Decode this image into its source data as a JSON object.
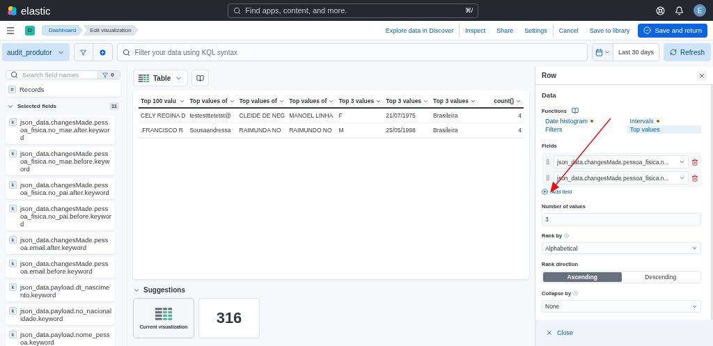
{
  "header": {
    "logo": "elastic",
    "search_placeholder": "Find apps, content, and more.",
    "shortcut": "⌘/",
    "avatar": "E"
  },
  "nav": {
    "app_badge": "D",
    "breadcrumbs": [
      {
        "label": "Dashboard",
        "selected": false
      },
      {
        "label": "Edit visualization",
        "selected": true
      }
    ],
    "actions": [
      {
        "label": "Explore data in Discover",
        "kind": "link"
      },
      {
        "label": "Inspect",
        "kind": "link"
      },
      {
        "label": "Share",
        "kind": "link"
      },
      {
        "label": "Settings",
        "kind": "link"
      },
      {
        "label": "Cancel",
        "kind": "link"
      },
      {
        "label": "Save to library",
        "kind": "link"
      },
      {
        "label": "Save and return",
        "kind": "primary"
      }
    ]
  },
  "query": {
    "data_view": "audit_produtor",
    "placeholder": "Filter your data using KQL syntax",
    "date_range": "Last 30 days",
    "refresh": "Refresh"
  },
  "sidebar": {
    "search_placeholder": "Search field names",
    "filter_count": "0",
    "records": {
      "type": "#",
      "name": "Records"
    },
    "selected_fields": {
      "label": "Selected fields",
      "count": "11",
      "expanded": true
    },
    "fields": [
      {
        "type": "k",
        "name": "json_data.changesMade.pessoa_fisica.no_mae.after.keyword"
      },
      {
        "type": "k",
        "name": "json_data.changesMade.pessoa_fisica.no_mae.before.keyword"
      },
      {
        "type": "k",
        "name": "json_data.changesMade.pessoa_fisica.no_pai.after.keyword"
      },
      {
        "type": "k",
        "name": "json_data.changesMade.pessoa_fisica.no_pai.before.keyword"
      },
      {
        "type": "k",
        "name": "json_data.changesMade.pessoa.email.after.keyword"
      },
      {
        "type": "k",
        "name": "json_data.changesMade.pessoa.email.before.keyword"
      },
      {
        "type": "k",
        "name": "json_data.payload.dt_nascimento.keyword"
      },
      {
        "type": "k",
        "name": "json_data.payload.no_nacionalidade.keyword"
      },
      {
        "type": "k",
        "name": "json_data.payload.nome_pessoa.keyword"
      }
    ]
  },
  "toolbar": {
    "chart_type": "Table"
  },
  "table": {
    "columns": [
      "Top 100 valu",
      "Top values of",
      "Top values of",
      "Top values of",
      "Top 3 values",
      "Top 3 values",
      "Top 3 values",
      "count()"
    ],
    "rows": [
      [
        "CELY REGINA D",
        "testestttetetst@",
        "CLEIDE DE NEG",
        "MANOEL LINHA",
        "F",
        "21/07/1975",
        "Brasileira",
        "4"
      ],
      [
        ".FRANCISCO R",
        "Sousaandressa",
        "RAIMUNDA NO",
        "RAIMUNDO NO",
        "M",
        "25/05/1998",
        "Brasileira",
        "4"
      ]
    ]
  },
  "suggestions": {
    "title": "Suggestions",
    "items": [
      {
        "kind": "chart",
        "label": "Current visualization"
      },
      {
        "kind": "metric",
        "value": "316"
      }
    ]
  },
  "panel": {
    "title": "Row",
    "section": "Data",
    "functions_label": "Functions",
    "functions": [
      {
        "label": "Date histogram",
        "selected": false,
        "dot": true
      },
      {
        "label": "Intervals",
        "selected": false,
        "dot": true
      },
      {
        "label": "Filters",
        "selected": false,
        "dot": false
      },
      {
        "label": "Top values",
        "selected": true,
        "dot": false
      }
    ],
    "fields_label": "Fields",
    "fields": [
      "json_data.changesMade.pessoa_fisica.n...",
      "json_data.changesMade.pessoa_fisica.n..."
    ],
    "add_field": "Add field",
    "number_of_values": {
      "label": "Number of values",
      "value": "3"
    },
    "rank_by": {
      "label": "Rank by",
      "value": "Alphabetical"
    },
    "rank_direction": {
      "label": "Rank direction",
      "options": [
        {
          "label": "Ascending",
          "selected": true
        },
        {
          "label": "Descending",
          "selected": false
        }
      ]
    },
    "collapse_by": {
      "label": "Collapse by",
      "value": "None"
    },
    "close": "Close"
  }
}
